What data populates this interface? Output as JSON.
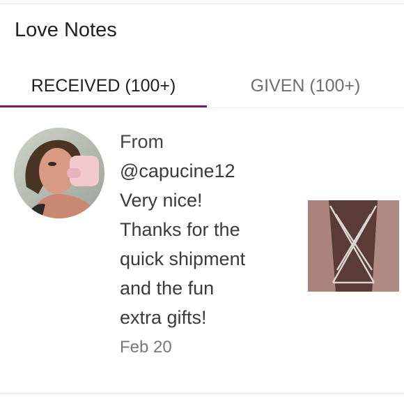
{
  "header": {
    "title": "Love Notes"
  },
  "tabs": [
    {
      "label": "RECEIVED (100+)",
      "active": true
    },
    {
      "label": "GIVEN (100+)",
      "active": false
    }
  ],
  "colors": {
    "accent": "#7a1f5c"
  },
  "note": {
    "from_label": "From",
    "username": "@capucine12",
    "message_lines": [
      "Very nice!",
      "Thanks for the",
      "quick shipment",
      "and the fun",
      "extra gifts!"
    ],
    "date": "Feb 20"
  }
}
